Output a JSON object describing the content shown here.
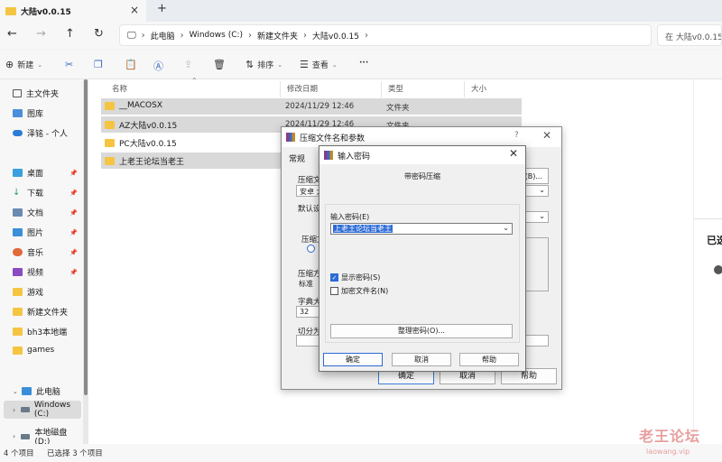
{
  "tab": {
    "title": "大陆v0.0.15",
    "close": "×",
    "new": "+"
  },
  "nav": {
    "back": "←",
    "forward": "→",
    "up": "↑",
    "refresh": "↻",
    "crumbs": [
      "此电脑",
      "Windows (C:)",
      "新建文件夹",
      "大陆v0.0.15"
    ],
    "search_placeholder": "在 大陆v0.0.15"
  },
  "commands": {
    "new": "新建",
    "sort": "排序",
    "view": "查看",
    "more": "···"
  },
  "sidebar": {
    "items": [
      {
        "label": "主文件夹",
        "icon": "home-icon"
      },
      {
        "label": "图库",
        "icon": "gallery-icon"
      },
      {
        "label": "泽铭 - 个人",
        "icon": "cloud-icon"
      },
      {
        "label": "桌面",
        "icon": "desktop-icon"
      },
      {
        "label": "下载",
        "icon": "download-icon"
      },
      {
        "label": "文档",
        "icon": "document-icon"
      },
      {
        "label": "图片",
        "icon": "picture-icon"
      },
      {
        "label": "音乐",
        "icon": "music-icon"
      },
      {
        "label": "视频",
        "icon": "video-icon"
      },
      {
        "label": "游戏",
        "icon": "folder-icon"
      },
      {
        "label": "新建文件夹",
        "icon": "folder-icon"
      },
      {
        "label": "bh3本地端",
        "icon": "folder-icon"
      },
      {
        "label": "games",
        "icon": "folder-icon"
      },
      {
        "label": "此电脑",
        "icon": "pc-icon"
      },
      {
        "label": "Windows (C:)",
        "icon": "drive-icon"
      },
      {
        "label": "本地磁盘 (D:)",
        "icon": "drive-icon"
      }
    ]
  },
  "filelist": {
    "columns": [
      "名称",
      "修改日期",
      "类型",
      "大小"
    ],
    "rows": [
      {
        "name": "__MACOSX",
        "date": "2024/11/29 12:46",
        "type": "文件夹"
      },
      {
        "name": "AZ大陆v0.0.15",
        "date": "2024/11/29 12:46",
        "type": "文件夹"
      },
      {
        "name": "PC大陆v0.0.15",
        "date": "",
        "type": ""
      },
      {
        "name": "上老王论坛当老王",
        "date": "",
        "type": ""
      }
    ]
  },
  "rightpane": {
    "text": "已选"
  },
  "status": {
    "count": "4 个项目",
    "selected": "已选择 3 个项目"
  },
  "dialog_back": {
    "title": "压缩文件名和参数",
    "help_mark": "?",
    "close": "✕",
    "tab_general": "常规",
    "label_archive": "压缩文",
    "archive_value": "安卓 大",
    "browse": "(B)...",
    "label_default": "默认设",
    "label_format": "压缩文",
    "label_method": "压缩方",
    "method_value": "标准",
    "label_dict": "字典大小",
    "dict_value": "32",
    "label_split": "切分为",
    "ok": "确定",
    "cancel": "取消",
    "help": "帮助"
  },
  "dialog_front": {
    "title": "输入密码",
    "close": "✕",
    "heading": "带密码压缩",
    "pw_label": "输入密码(E)",
    "pw_value": "上老王论坛当老王",
    "show_pw": "显示密码(S)",
    "encrypt_names": "加密文件名(N)",
    "organize": "整理密码(O)...",
    "ok": "确定",
    "cancel": "取消",
    "help": "帮助"
  },
  "watermark": {
    "cn": "老王论坛",
    "url": "laowang.vip"
  }
}
